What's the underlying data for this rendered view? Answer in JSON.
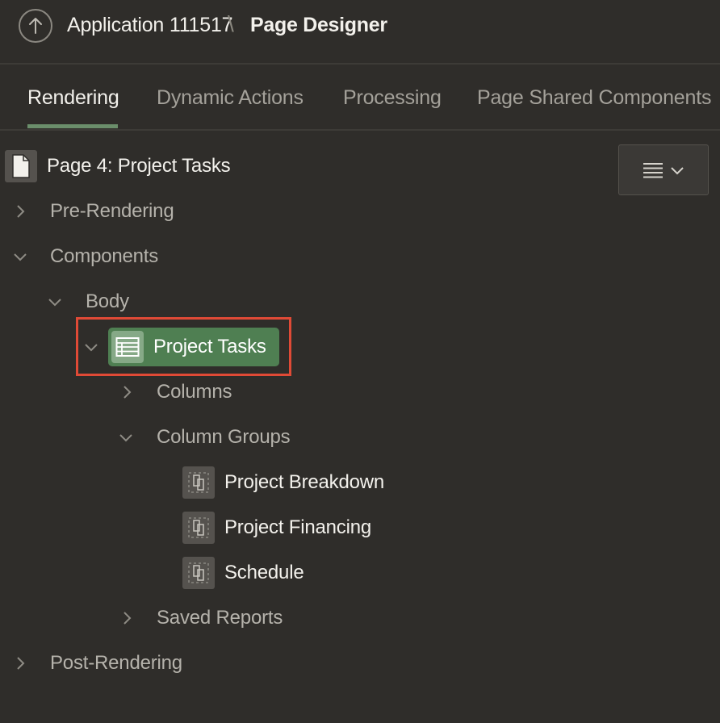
{
  "header": {
    "app_title": "Application 111517",
    "separator": "\\",
    "page_title": "Page Designer",
    "up_icon": "arrow-up-circle-icon"
  },
  "tabs": [
    {
      "label": "Rendering",
      "active": true
    },
    {
      "label": "Dynamic Actions",
      "active": false
    },
    {
      "label": "Processing",
      "active": false
    },
    {
      "label": "Page Shared Components",
      "active": false
    }
  ],
  "toolbar": {
    "menu_icon": "hamburger-menu-icon",
    "dropdown_icon": "chevron-down-icon"
  },
  "tree": {
    "page_label": "Page 4: Project Tasks",
    "pre_rendering": "Pre-Rendering",
    "components": "Components",
    "body": "Body",
    "region": "Project Tasks",
    "columns": "Columns",
    "column_groups": "Column Groups",
    "groups": [
      {
        "label": "Project Breakdown"
      },
      {
        "label": "Project Financing"
      },
      {
        "label": "Schedule"
      }
    ],
    "saved_reports": "Saved Reports",
    "post_rendering": "Post-Rendering"
  },
  "colors": {
    "background": "#2f2d2a",
    "active_tab_underline": "#6b8e6b",
    "selected_region": "#4f7f52",
    "highlight_border": "#e04a36"
  }
}
